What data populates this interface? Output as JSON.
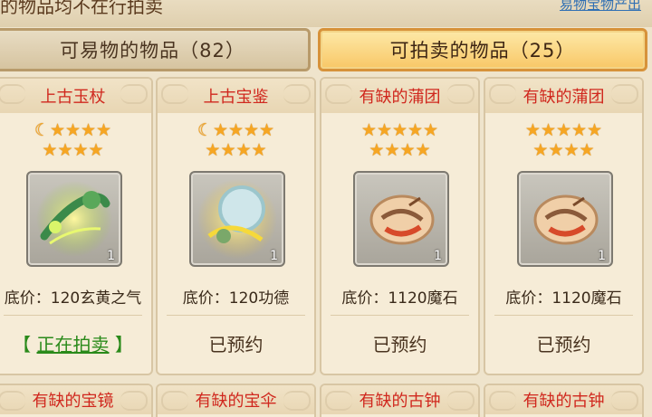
{
  "header": {
    "title": "的物品均不在行拍卖",
    "link": "易物宝物产出"
  },
  "tabs": [
    {
      "label": "可易物的物品（82）",
      "active": false
    },
    {
      "label": "可拍卖的物品（25）",
      "active": true
    }
  ],
  "items": [
    {
      "name": "上古玉杖",
      "stars_line1": "☾★★★★",
      "stars_line2": "★★★★",
      "icon": "jade-staff-icon",
      "count": "1",
      "price": "底价：120玄黄之气",
      "status_prefix": "【 ",
      "status": "正在拍卖",
      "status_suffix": " 】"
    },
    {
      "name": "上古宝鉴",
      "stars_line1": "☾★★★★",
      "stars_line2": "★★★★",
      "icon": "treasure-mirror-icon",
      "count": "1",
      "price": "底价：120功德",
      "status_prefix": "",
      "status": "已预约",
      "status_suffix": ""
    },
    {
      "name": "有缺的蒲团",
      "stars_line1": "★★★★★",
      "stars_line2": "★★★★",
      "icon": "cushion-icon",
      "count": "1",
      "price": "底价：1120魔石",
      "status_prefix": "",
      "status": "已预约",
      "status_suffix": ""
    },
    {
      "name": "有缺的蒲团",
      "stars_line1": "★★★★★",
      "stars_line2": "★★★★",
      "icon": "cushion-icon",
      "count": "1",
      "price": "底价：1120魔石",
      "status_prefix": "",
      "status": "已预约",
      "status_suffix": ""
    }
  ],
  "next_row": [
    {
      "name": "有缺的宝镜"
    },
    {
      "name": "有缺的宝伞"
    },
    {
      "name": "有缺的古钟"
    },
    {
      "name": "有缺的古钟"
    }
  ]
}
